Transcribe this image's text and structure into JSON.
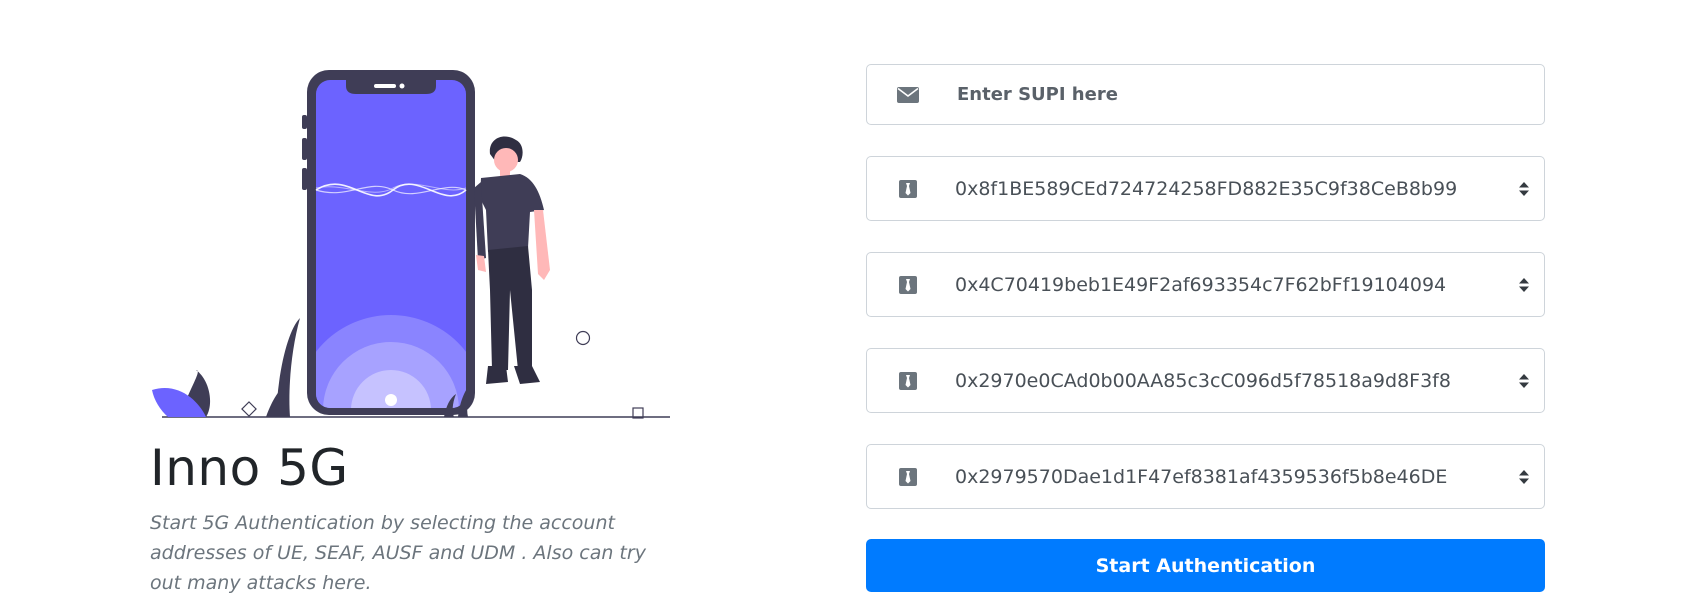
{
  "app": {
    "title": "Inno 5G",
    "description": "Start 5G Authentication by selecting the account addresses of UE, SEAF, AUSF and UDM . Also can try out many attacks here."
  },
  "form": {
    "supi": {
      "placeholder": "Enter SUPI here",
      "value": "",
      "icon": "envelope-icon"
    },
    "selects": [
      {
        "icon": "tie-icon",
        "selected": "0x8f1BE589CEd724724258FD882E35C9f38CeB8b99"
      },
      {
        "icon": "tie-icon",
        "selected": "0x4C70419beb1E49F2af693354c7F62bFf19104094"
      },
      {
        "icon": "tie-icon",
        "selected": "0x2970e0CAd0b00AA85c3cC096d5f78518a9d8F3f8"
      },
      {
        "icon": "tie-icon",
        "selected": "0x2979570Dae1d1F47ef8381af4359536f5b8e46DE"
      }
    ],
    "submit_label": "Start Authentication"
  },
  "colors": {
    "accent": "#007bff",
    "illustration_primary": "#6c63ff",
    "illustration_dark": "#3f3d56",
    "skin": "#ffb8b8",
    "icon_gray": "#6c757d",
    "border": "#ced4da"
  }
}
